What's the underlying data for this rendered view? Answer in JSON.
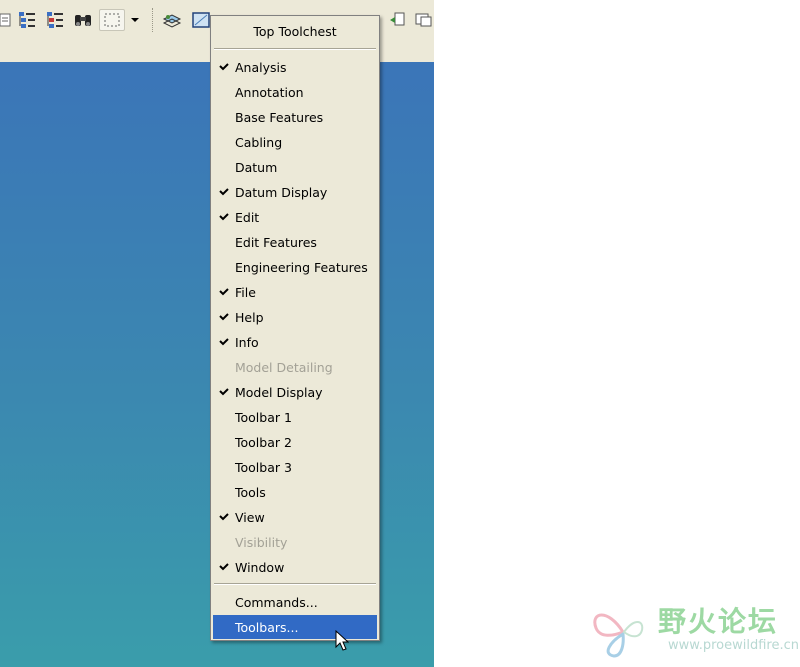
{
  "menu": {
    "title": "Top Toolchest",
    "items": [
      {
        "label": "Analysis",
        "checked": true,
        "enabled": true
      },
      {
        "label": "Annotation",
        "checked": false,
        "enabled": true
      },
      {
        "label": "Base Features",
        "checked": false,
        "enabled": true
      },
      {
        "label": "Cabling",
        "checked": false,
        "enabled": true
      },
      {
        "label": "Datum",
        "checked": false,
        "enabled": true
      },
      {
        "label": "Datum Display",
        "checked": true,
        "enabled": true
      },
      {
        "label": "Edit",
        "checked": true,
        "enabled": true
      },
      {
        "label": "Edit Features",
        "checked": false,
        "enabled": true
      },
      {
        "label": "Engineering Features",
        "checked": false,
        "enabled": true
      },
      {
        "label": "File",
        "checked": true,
        "enabled": true
      },
      {
        "label": "Help",
        "checked": true,
        "enabled": true
      },
      {
        "label": "Info",
        "checked": true,
        "enabled": true
      },
      {
        "label": "Model Detailing",
        "checked": false,
        "enabled": false
      },
      {
        "label": "Model Display",
        "checked": true,
        "enabled": true
      },
      {
        "label": "Toolbar 1",
        "checked": false,
        "enabled": true
      },
      {
        "label": "Toolbar 2",
        "checked": false,
        "enabled": true
      },
      {
        "label": "Toolbar 3",
        "checked": false,
        "enabled": true
      },
      {
        "label": "Tools",
        "checked": false,
        "enabled": true
      },
      {
        "label": "View",
        "checked": true,
        "enabled": true
      },
      {
        "label": "Visibility",
        "checked": false,
        "enabled": false
      },
      {
        "label": "Window",
        "checked": true,
        "enabled": true
      }
    ],
    "commands_label": "Commands...",
    "toolbars_label": "Toolbars...",
    "highlighted": "Toolbars..."
  },
  "toolbar": {
    "icons": [
      "list-icon",
      "tree-filter-icon",
      "tree-settings-icon",
      "binoculars-icon",
      "select-box-icon",
      "dropdown-arrow-icon",
      "layer-icon",
      "view-manager-icon"
    ]
  },
  "colors": {
    "menu_bg": "#ece9d8",
    "highlight": "#316ac5",
    "viewport_top": "#3b75b8",
    "viewport_bottom": "#3a9dab"
  },
  "watermark": {
    "name": "野火论坛",
    "url": "www.proewildfire.cn"
  }
}
